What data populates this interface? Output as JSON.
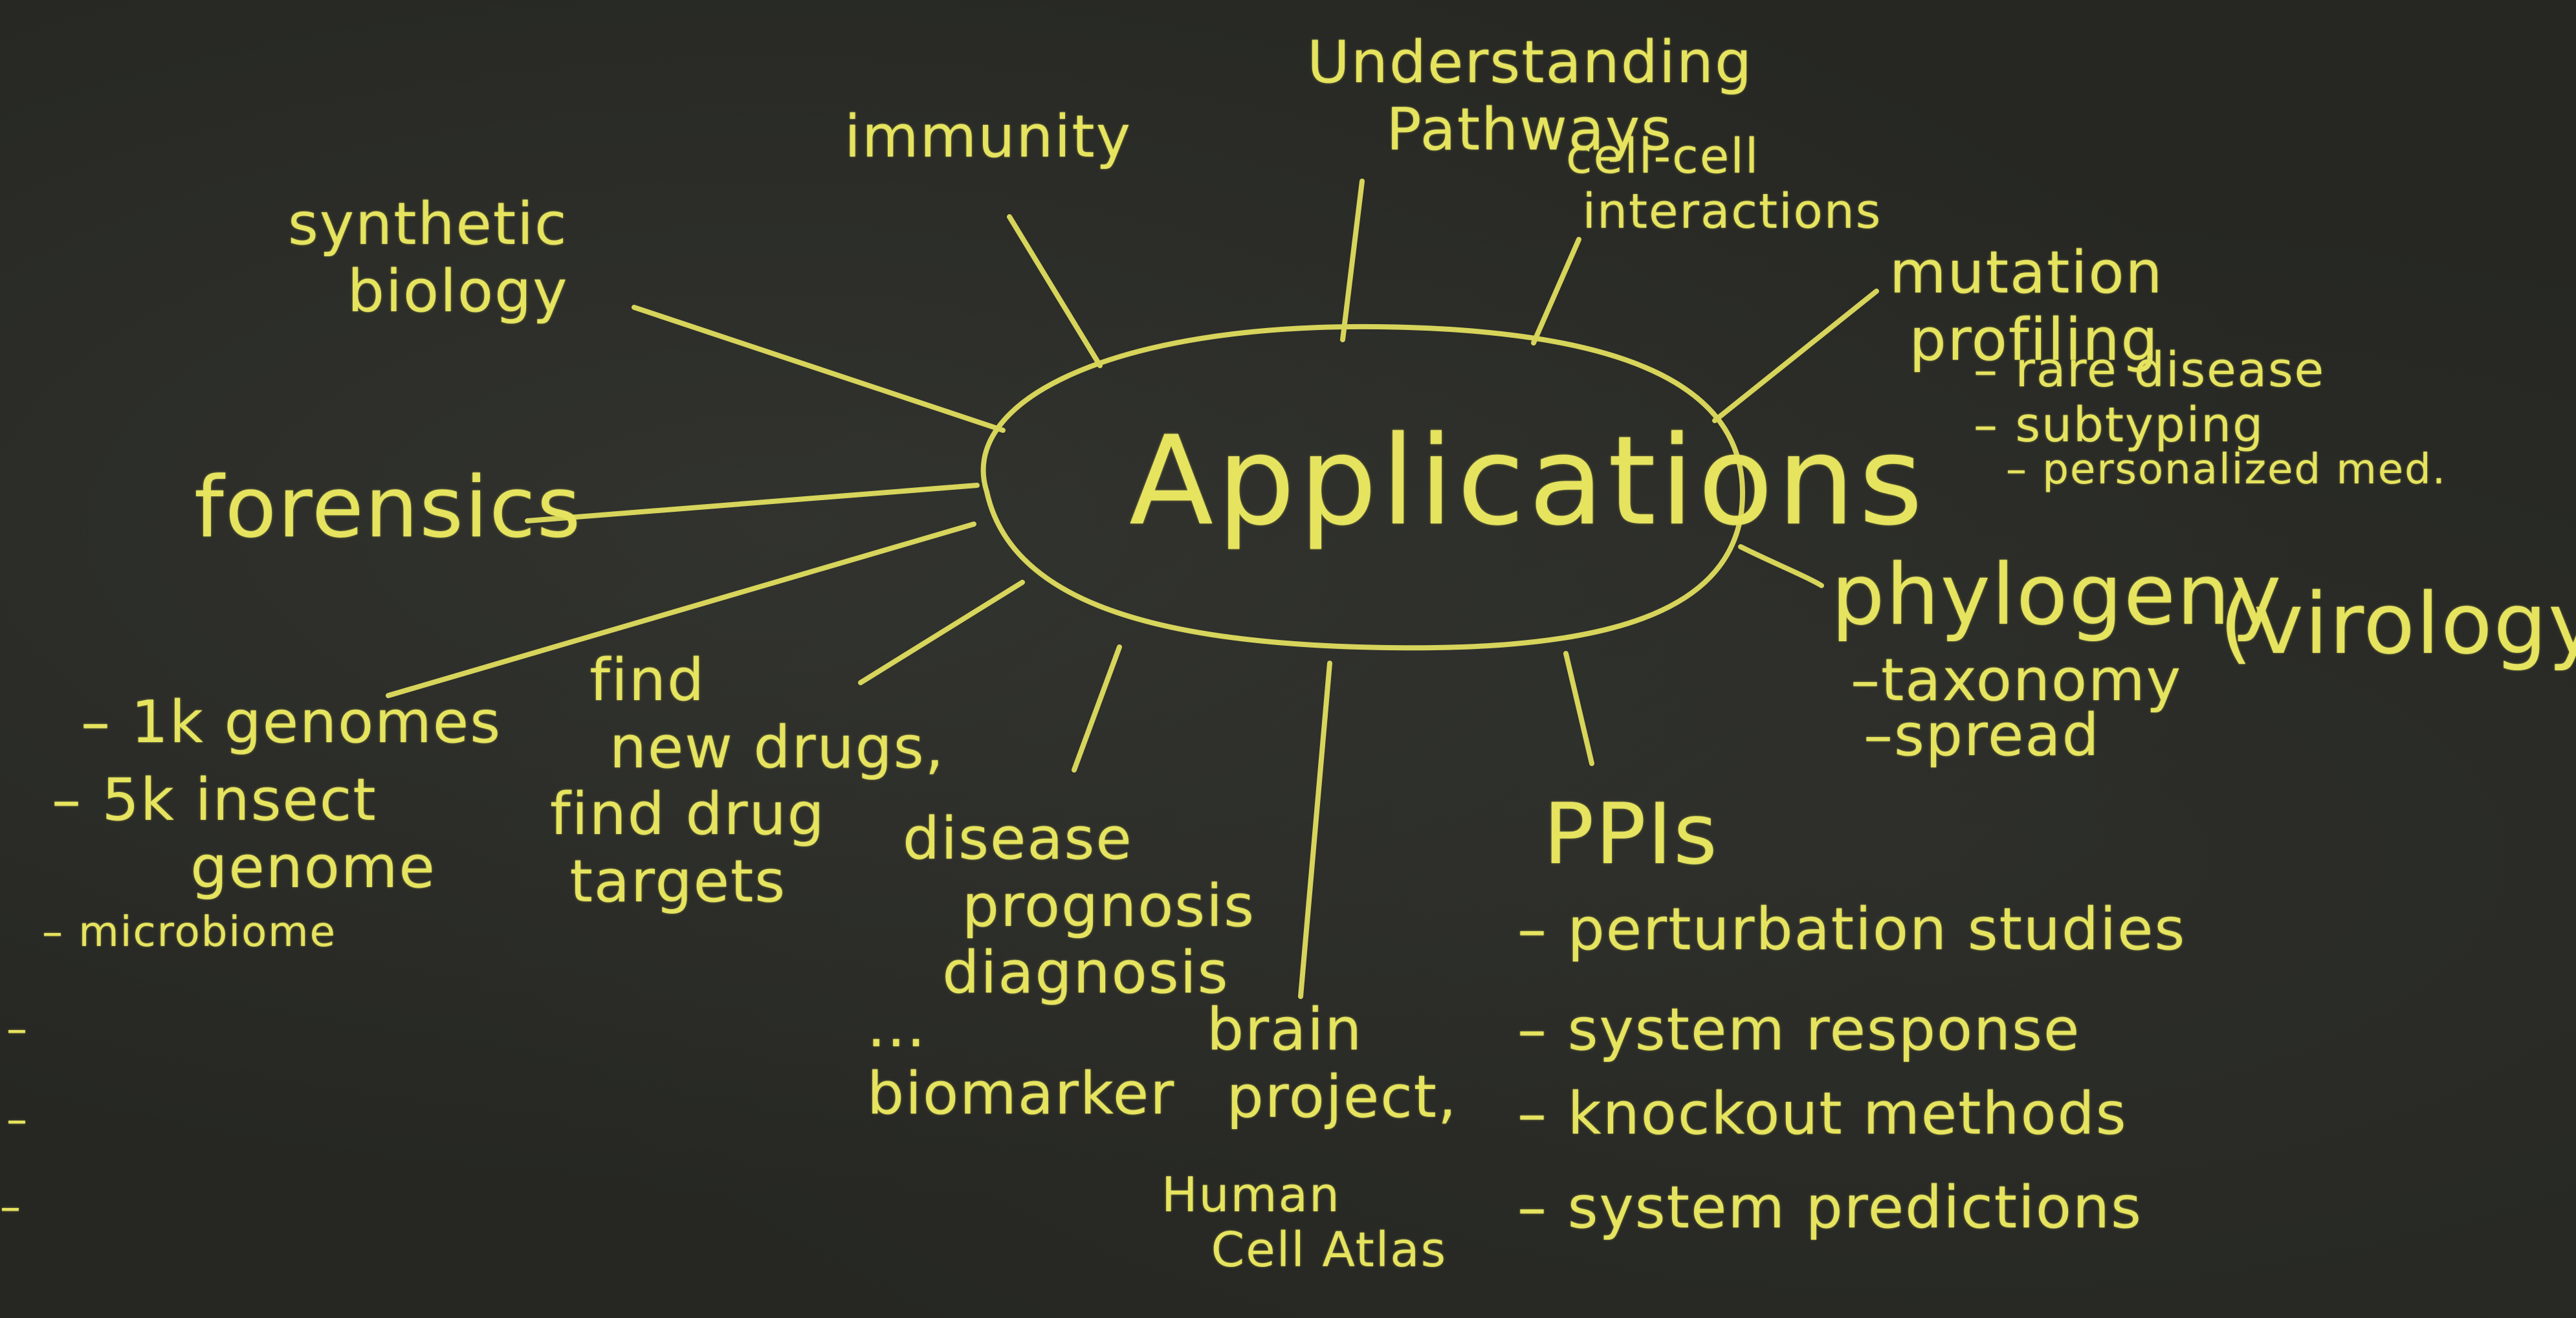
{
  "board": {
    "background_color": "#262723",
    "chalk_color": "#e6e35f",
    "hub": "Applications",
    "nodes": {
      "synthetic_biology": "synthetic\n   biology",
      "immunity": "immunity",
      "understanding_pathways": "Understanding\n    Pathways",
      "cell_cell": "cell-cell\n interactions",
      "mutation_profiling": "mutation\n profiling",
      "mutation_items": [
        "– rare disease",
        "– subtyping",
        "– personalized med."
      ],
      "forensics": "forensics",
      "genomes_items": [
        "– 1k genomes",
        "– 5k insect\n       genome",
        "– microbiome",
        "–",
        "–",
        "–"
      ],
      "find_drugs": "  find\n   new drugs,\nfind drug\n targets",
      "disease": "disease\n   prognosis\n  diagnosis",
      "biomarker": "...\nbiomarker",
      "brain_project": "brain\n project,",
      "human_cell_atlas": "Human\n   Cell Atlas",
      "phylogeny": "phylogeny",
      "virology": "(virology)",
      "phylogeny_items": [
        "–taxonomy",
        "–spread"
      ],
      "ppis": "PPIs",
      "ppis_items": [
        "– perturbation studies",
        "– system response",
        "– knockout methods",
        "– system predictions"
      ]
    }
  }
}
